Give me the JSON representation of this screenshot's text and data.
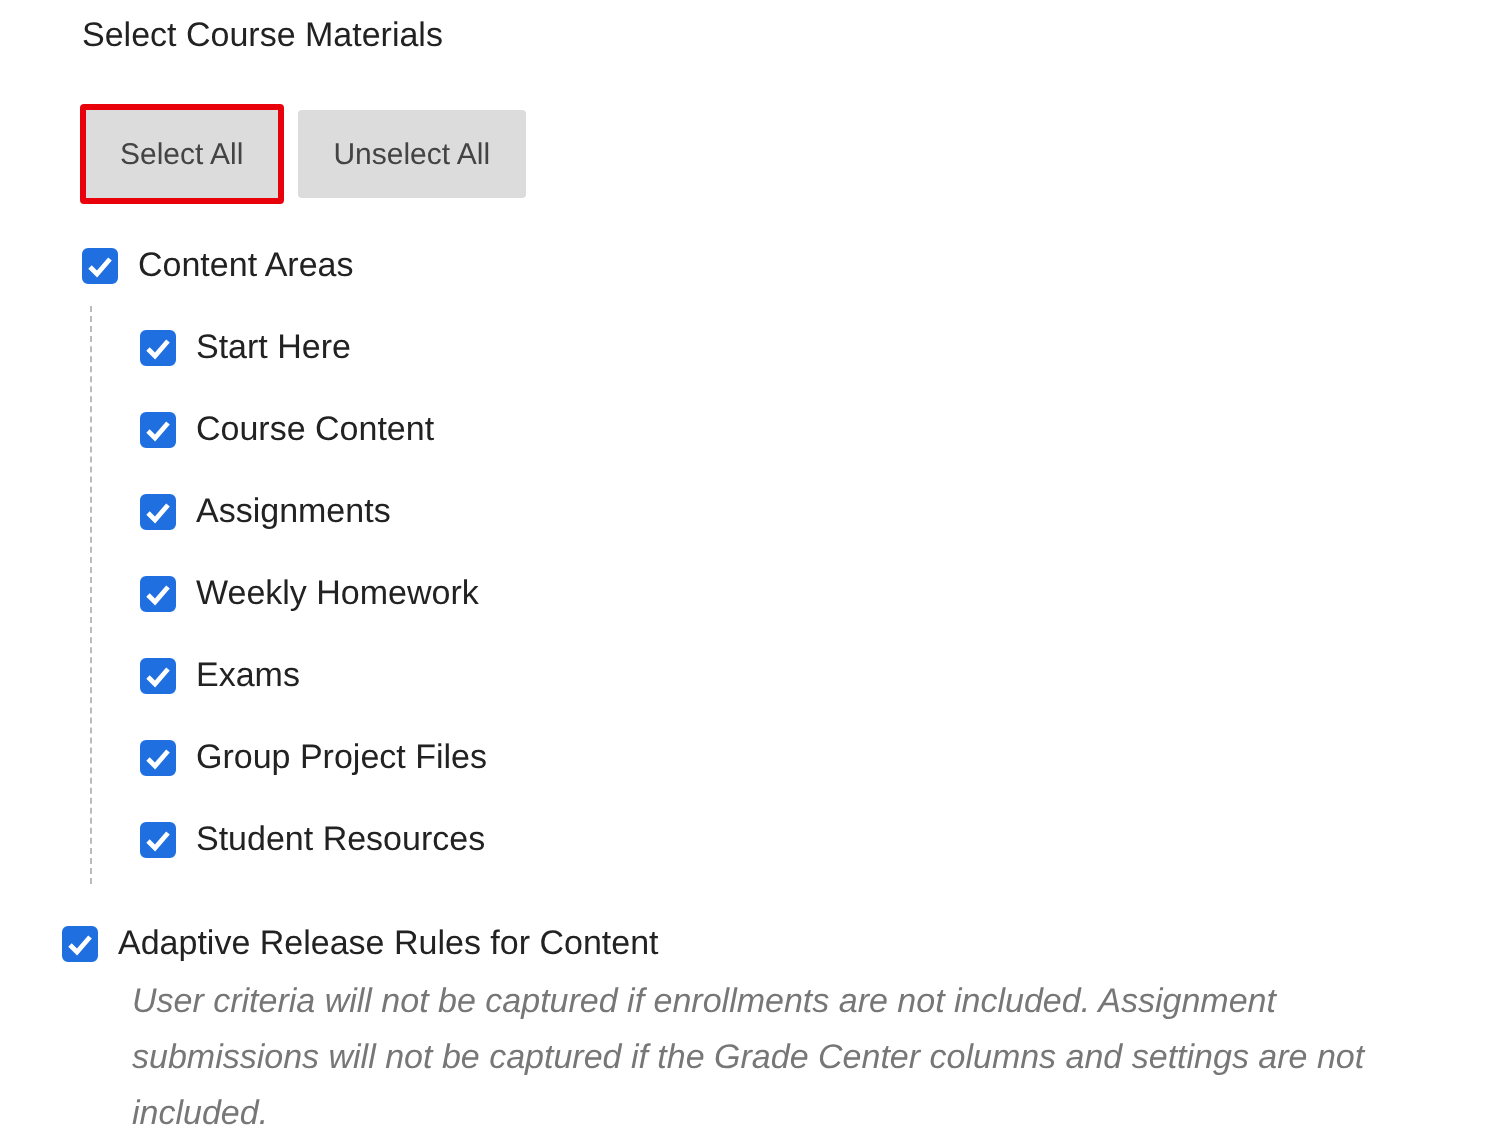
{
  "section_title": "Select Course Materials",
  "buttons": [
    {
      "label": "Select All",
      "outlined": true
    },
    {
      "label": "Unselect All",
      "outlined": false
    }
  ],
  "content_tree": [
    {
      "label": "Content Areas",
      "checked": true,
      "children": [
        {
          "label": "Start Here",
          "checked": true
        },
        {
          "label": "Course Content",
          "checked": true
        },
        {
          "label": "Assignments",
          "checked": true
        },
        {
          "label": "Weekly Homework",
          "checked": true
        },
        {
          "label": "Exams",
          "checked": true
        },
        {
          "label": "Group Project Files",
          "checked": true
        },
        {
          "label": "Student Resources",
          "checked": true
        }
      ]
    }
  ],
  "options": [
    {
      "label": "Adaptive Release Rules for Content",
      "checked": true,
      "note": "User criteria will not be captured if enrollments are not included. Assignment submissions will not be captured if the Grade Center columns and settings are not included."
    }
  ]
}
